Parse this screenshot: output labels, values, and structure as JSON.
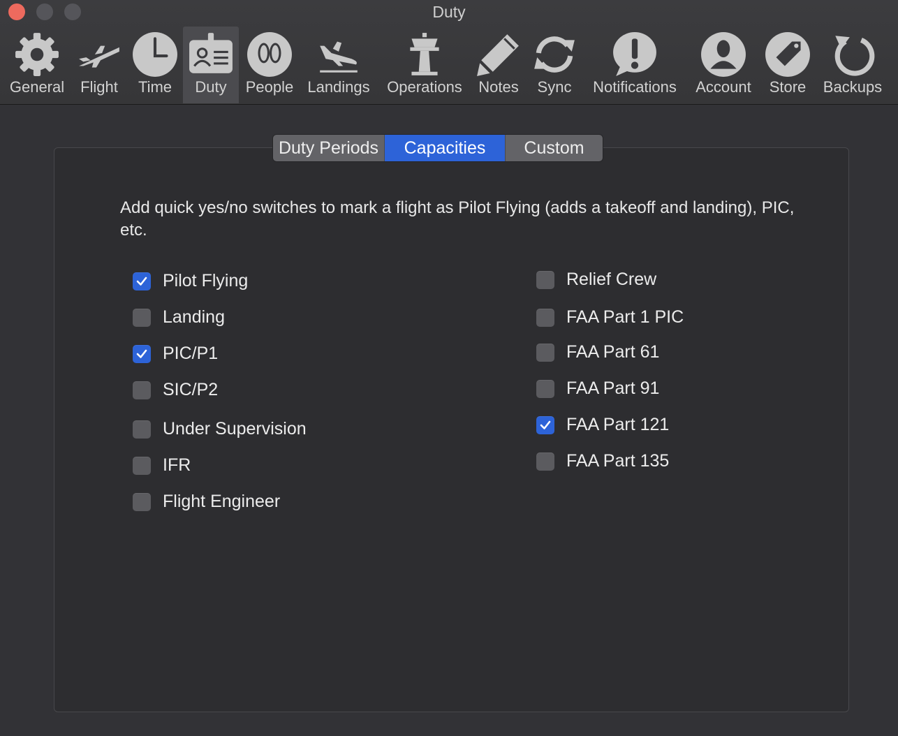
{
  "window": {
    "title": "Duty"
  },
  "toolbar": [
    {
      "label": "General",
      "icon": "gear-icon"
    },
    {
      "label": "Flight",
      "icon": "airplane-icon"
    },
    {
      "label": "Time",
      "icon": "clock-icon"
    },
    {
      "label": "Duty",
      "icon": "id-badge-icon"
    },
    {
      "label": "People",
      "icon": "people-icon"
    },
    {
      "label": "Landings",
      "icon": "landing-icon"
    },
    {
      "label": "Operations",
      "icon": "control-tower-icon"
    },
    {
      "label": "Notes",
      "icon": "pencil-icon"
    },
    {
      "label": "Sync",
      "icon": "sync-icon"
    },
    {
      "label": "Notifications",
      "icon": "exclamation-bubble-icon"
    },
    {
      "label": "Account",
      "icon": "account-icon"
    },
    {
      "label": "Store",
      "icon": "tag-icon"
    },
    {
      "label": "Backups",
      "icon": "backup-icon"
    }
  ],
  "tabs": [
    "Duty Periods",
    "Capacities",
    "Custom"
  ],
  "selected_tab": "Capacities",
  "description": "Add quick yes/no switches to mark a flight as Pilot Flying (adds a takeoff and landing), PIC, etc.",
  "capacities_left": [
    {
      "label": "Pilot Flying",
      "checked": true
    },
    {
      "label": "Landing",
      "checked": false
    },
    {
      "label": "PIC/P1",
      "checked": true
    },
    {
      "label": "SIC/P2",
      "checked": false
    },
    {
      "label": "Under Supervision",
      "checked": false
    },
    {
      "label": "IFR",
      "checked": false
    },
    {
      "label": "Flight Engineer",
      "checked": false
    }
  ],
  "capacities_right": [
    {
      "label": "Relief Crew",
      "checked": false
    },
    {
      "label": "FAA Part 1 PIC",
      "checked": false
    },
    {
      "label": "FAA Part 61",
      "checked": false
    },
    {
      "label": "FAA Part 91",
      "checked": false
    },
    {
      "label": "FAA Part 121",
      "checked": true
    },
    {
      "label": "FAA Part 135",
      "checked": false
    }
  ],
  "colors": {
    "accent": "#2d63d8",
    "background": "#323236",
    "close_button": "#ed6a5e"
  }
}
